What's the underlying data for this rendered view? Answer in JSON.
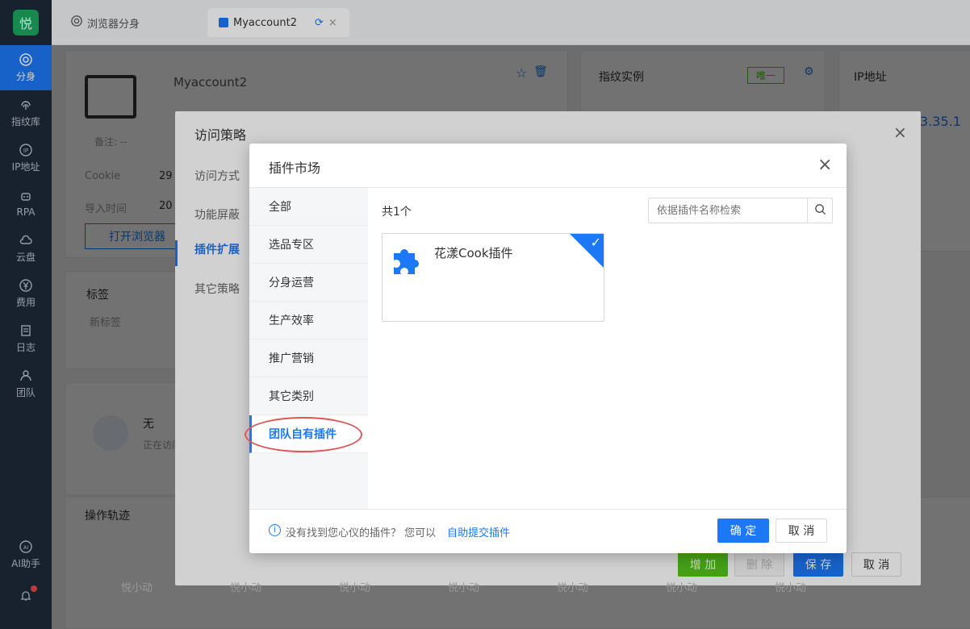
{
  "sidebar": {
    "logo": "悦",
    "items": [
      {
        "label": "分身",
        "icon": "chrome-icon"
      },
      {
        "label": "指纹库",
        "icon": "fingerprint-icon"
      },
      {
        "label": "IP地址",
        "icon": "ip-icon"
      },
      {
        "label": "RPA",
        "icon": "robot-icon"
      },
      {
        "label": "云盘",
        "icon": "cloud-drive-icon"
      },
      {
        "label": "费用",
        "icon": "yen-icon"
      },
      {
        "label": "日志",
        "icon": "log-icon"
      },
      {
        "label": "团队",
        "icon": "team-icon"
      }
    ],
    "ai": "AI助手"
  },
  "tabs": [
    {
      "label": "浏览器分身"
    },
    {
      "label": "Myaccount2"
    }
  ],
  "profile": {
    "name": "Myaccount2",
    "note": "备注: --",
    "cookie_label": "Cookie",
    "cookie_value": "29",
    "import_label": "导入时间",
    "import_value": "20",
    "open_btn": "打开浏览器"
  },
  "fingerprint_card": {
    "title": "指纹实例",
    "badge": "唯一"
  },
  "ip_card": {
    "title": "IP地址",
    "ip_fragment": "3.35.1"
  },
  "tags_card": {
    "title": "标签",
    "new_tag": "新标签"
  },
  "access_card": {
    "name": "无",
    "status": "正在访问"
  },
  "trail_card": {
    "title": "操作轨迹"
  },
  "bottom_users": [
    "悦小动",
    "悦小动",
    "悦小动",
    "悦小动",
    "悦小动",
    "悦小动",
    "悦小动",
    "悦小动"
  ],
  "policy_dialog": {
    "title": "访问策略",
    "menu": [
      "访问方式",
      "功能屏蔽",
      "插件扩展",
      "其它策略"
    ],
    "active_index": 2,
    "btn_add": "增 加",
    "btn_delete": "删 除",
    "btn_save": "保 存",
    "btn_cancel": "取 消"
  },
  "market_dialog": {
    "title": "插件市场",
    "categories": [
      "全部",
      "选品专区",
      "分身运营",
      "生产效率",
      "推广营销",
      "其它类别",
      "团队自有插件"
    ],
    "active_category": "团队自有插件",
    "count": "共1个",
    "search_placeholder": "依据插件名称检索",
    "plugins": [
      {
        "name": "花漾Cook插件",
        "selected": true
      }
    ],
    "footer_hint": "没有找到您心仪的插件？ 您可以",
    "footer_link": "自助提交插件",
    "btn_ok": "确 定",
    "btn_cancel": "取 消"
  },
  "colors": {
    "primary": "#1d78f5",
    "sidebar": "#1e2a3a",
    "green": "#52c41a",
    "highlight": "#e05555"
  }
}
